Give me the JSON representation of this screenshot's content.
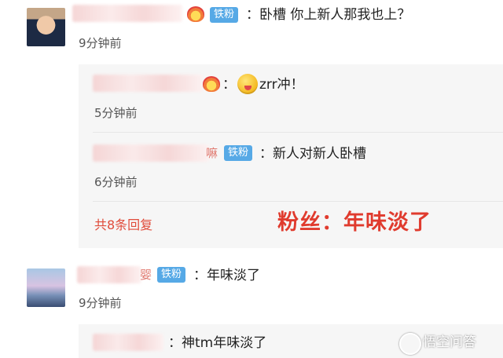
{
  "comments": [
    {
      "badge": "铁粉",
      "text": "：卧槽 你上新人那我也上？",
      "time": "9分钟前",
      "replies": [
        {
          "text": "：",
          "text2": "zrr冲！",
          "time": "5分钟前"
        },
        {
          "name_tail": "嘛",
          "badge": "铁粉",
          "text": "：新人对新人卧槽",
          "time": "6分钟前"
        }
      ],
      "reply_count_link": "共8条回复"
    },
    {
      "name_tail": "婴",
      "badge": "铁粉",
      "text": "：年味淡了",
      "time": "9分钟前",
      "replies": [
        {
          "text": "：神tm年味淡了"
        }
      ]
    }
  ],
  "annotation": "粉丝：年味淡了",
  "watermark": "悟空问答"
}
